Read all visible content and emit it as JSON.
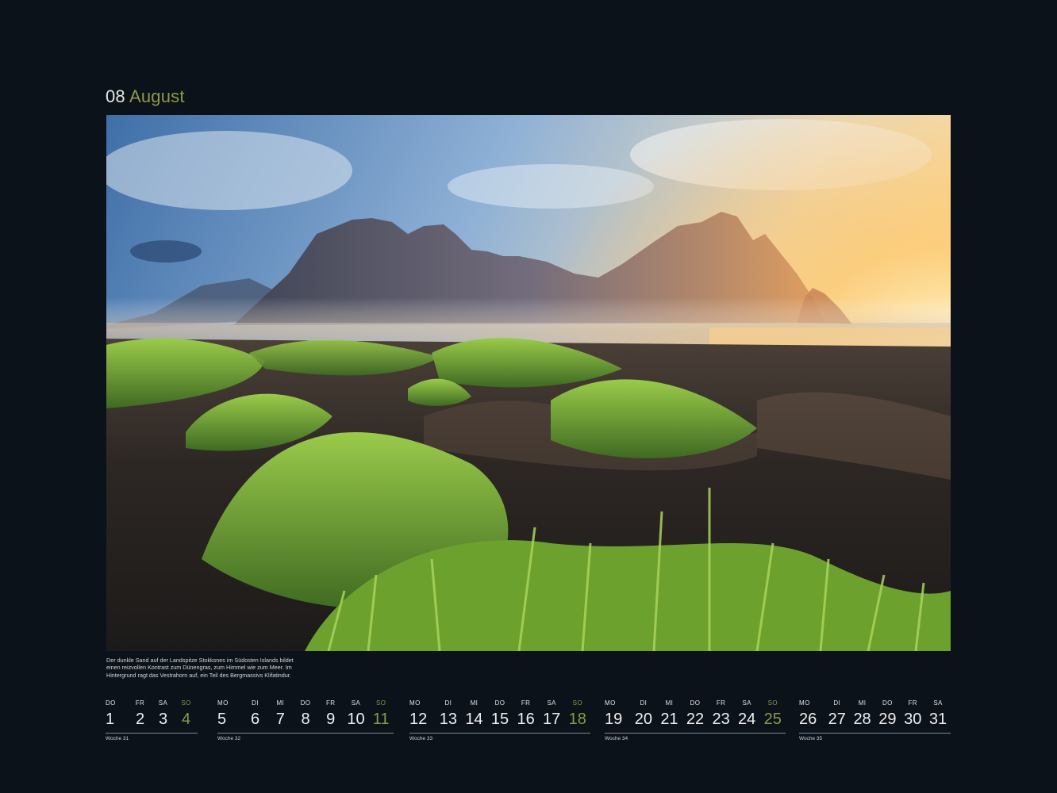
{
  "header": {
    "month_number": "08",
    "month_name": "August"
  },
  "photo": {
    "subject": "landscape-photo",
    "colors": {
      "sky_top": "#4f7fb7",
      "sun": "#ffd27a",
      "sand": "#2b2724",
      "grass": "#7fae3a"
    }
  },
  "caption": "Der dunkle Sand auf der Landspitze Stokksnes im Südosten Islands bildet einen reizvollen Kontrast zum Dünengras, zum Himmel wie zum Meer. Im Hintergrund ragt das Vestrahorn auf, ein Teil des Bergmassivs Klifatindur.",
  "weeks": [
    {
      "label": "Woche 31",
      "days": [
        {
          "dow": "DO",
          "num": "1"
        },
        {
          "dow": "FR",
          "num": "2"
        },
        {
          "dow": "SA",
          "num": "3"
        },
        {
          "dow": "SO",
          "num": "4",
          "sunday": true
        }
      ]
    },
    {
      "label": "Woche 32",
      "days": [
        {
          "dow": "MO",
          "num": "5"
        },
        {
          "dow": "DI",
          "num": "6"
        },
        {
          "dow": "MI",
          "num": "7"
        },
        {
          "dow": "DO",
          "num": "8"
        },
        {
          "dow": "FR",
          "num": "9"
        },
        {
          "dow": "SA",
          "num": "10"
        },
        {
          "dow": "SO",
          "num": "11",
          "sunday": true
        }
      ]
    },
    {
      "label": "Woche 33",
      "days": [
        {
          "dow": "MO",
          "num": "12"
        },
        {
          "dow": "DI",
          "num": "13"
        },
        {
          "dow": "MI",
          "num": "14"
        },
        {
          "dow": "DO",
          "num": "15"
        },
        {
          "dow": "FR",
          "num": "16"
        },
        {
          "dow": "SA",
          "num": "17"
        },
        {
          "dow": "SO",
          "num": "18",
          "sunday": true
        }
      ]
    },
    {
      "label": "Woche 34",
      "days": [
        {
          "dow": "MO",
          "num": "19"
        },
        {
          "dow": "DI",
          "num": "20"
        },
        {
          "dow": "MI",
          "num": "21"
        },
        {
          "dow": "DO",
          "num": "22"
        },
        {
          "dow": "FR",
          "num": "23"
        },
        {
          "dow": "SA",
          "num": "24"
        },
        {
          "dow": "SO",
          "num": "25",
          "sunday": true
        }
      ]
    },
    {
      "label": "Woche 35",
      "days": [
        {
          "dow": "MO",
          "num": "26"
        },
        {
          "dow": "DI",
          "num": "27"
        },
        {
          "dow": "MI",
          "num": "28"
        },
        {
          "dow": "DO",
          "num": "29"
        },
        {
          "dow": "FR",
          "num": "30"
        },
        {
          "dow": "SA",
          "num": "31"
        }
      ]
    }
  ],
  "colors": {
    "background": "#0b121a",
    "accent": "#8e9a45",
    "text": "#f0f0f0"
  }
}
